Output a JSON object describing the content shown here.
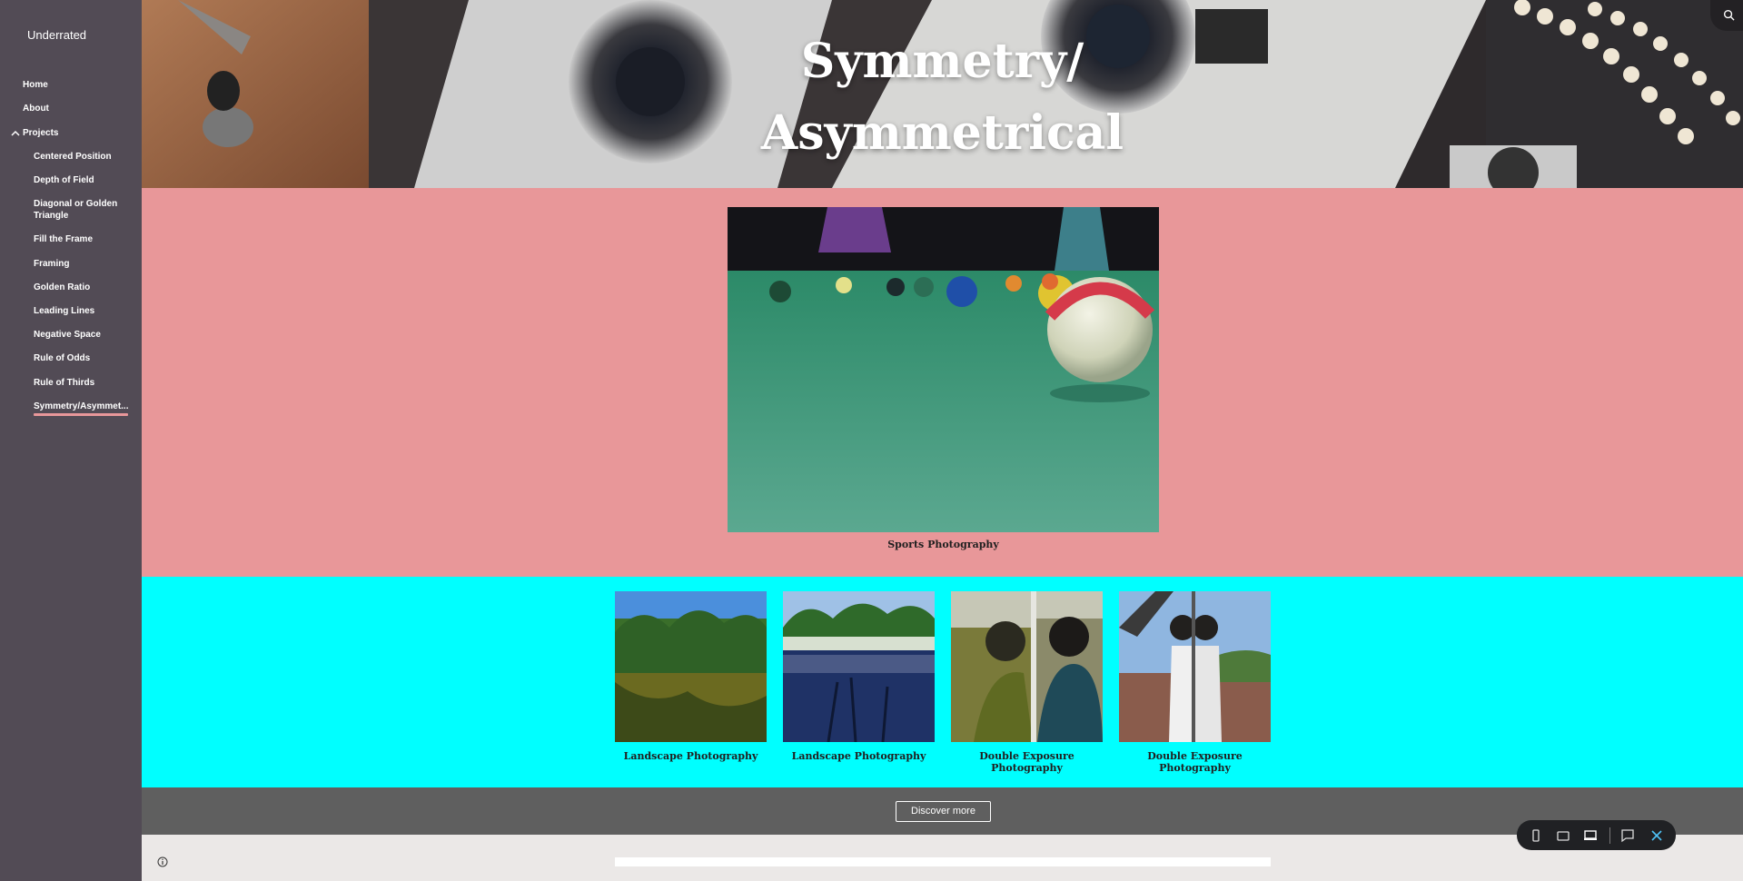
{
  "site": {
    "title": "Underrated"
  },
  "nav": {
    "home": "Home",
    "about": "About",
    "projects": "Projects",
    "sub_items": [
      "Centered Position",
      "Depth of Field",
      "Diagonal or Golden Triangle",
      "Fill the Frame",
      "Framing",
      "Golden Ratio",
      "Leading Lines",
      "Negative Space",
      "Rule of Odds",
      "Rule of Thirds",
      "Symmetry/Asymmet..."
    ],
    "active_item": "Symmetry/Asymmet..."
  },
  "hero": {
    "title_line1": "Symmetry/",
    "title_line2": "Asymmetrical"
  },
  "featured": {
    "caption": "Sports Photography"
  },
  "gallery": {
    "captions": [
      "Landscape Photography",
      "Landscape Photography",
      "Double Exposure Photography",
      "Double Exposure Photography"
    ]
  },
  "discover": {
    "label": "Discover more"
  },
  "colors": {
    "sidebar_bg": "#524b55",
    "pink_section": "#e89799",
    "cyan_section": "#00ffff",
    "discover_band": "#5f5f5f",
    "active_underline": "#e8979a"
  },
  "icons": {
    "search": "search-icon",
    "info": "info-icon",
    "chevron": "chevron-up-icon",
    "toolbar": [
      "phone-icon",
      "tablet-icon",
      "laptop-icon",
      "feedback-icon",
      "close-icon"
    ]
  }
}
